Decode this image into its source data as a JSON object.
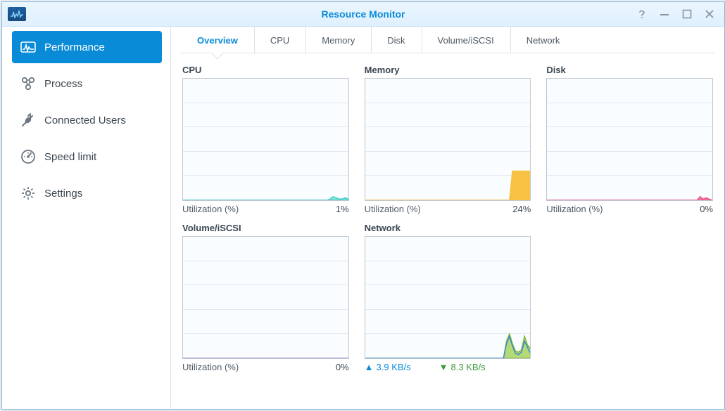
{
  "window": {
    "title": "Resource Monitor"
  },
  "sidebar": {
    "items": [
      {
        "label": "Performance",
        "active": true
      },
      {
        "label": "Process"
      },
      {
        "label": "Connected Users"
      },
      {
        "label": "Speed limit"
      },
      {
        "label": "Settings"
      }
    ]
  },
  "tabs": [
    {
      "label": "Overview",
      "active": true
    },
    {
      "label": "CPU"
    },
    {
      "label": "Memory"
    },
    {
      "label": "Disk"
    },
    {
      "label": "Volume/iSCSI"
    },
    {
      "label": "Network"
    }
  ],
  "cards": {
    "cpu": {
      "title": "CPU",
      "caption_label": "Utilization (%)",
      "caption_value": "1%"
    },
    "memory": {
      "title": "Memory",
      "caption_label": "Utilization (%)",
      "caption_value": "24%"
    },
    "disk": {
      "title": "Disk",
      "caption_label": "Utilization (%)",
      "caption_value": "0%"
    },
    "volume": {
      "title": "Volume/iSCSI",
      "caption_label": "Utilization (%)",
      "caption_value": "0%"
    },
    "network": {
      "title": "Network",
      "upload": "3.9 KB/s",
      "download": "8.3 KB/s"
    }
  },
  "chart_data": [
    {
      "id": "cpu",
      "type": "area",
      "ylim": [
        0,
        100
      ],
      "ylabel": "Utilization (%)",
      "latest": 1,
      "values": [
        0,
        0,
        0,
        0,
        0,
        0,
        0,
        0,
        0,
        0,
        0,
        0,
        0,
        0,
        0,
        0,
        0,
        0,
        0,
        0,
        0,
        0,
        0,
        0,
        0,
        0,
        0,
        0,
        0,
        0,
        0,
        0,
        0,
        0,
        0,
        0,
        0,
        0,
        0,
        0,
        0,
        0,
        0,
        0,
        0,
        0,
        0,
        0,
        0,
        1,
        3,
        2,
        1,
        1,
        2,
        1
      ]
    },
    {
      "id": "memory",
      "type": "area",
      "ylim": [
        0,
        100
      ],
      "ylabel": "Utilization (%)",
      "latest": 24,
      "values": [
        0,
        0,
        0,
        0,
        0,
        0,
        0,
        0,
        0,
        0,
        0,
        0,
        0,
        0,
        0,
        0,
        0,
        0,
        0,
        0,
        0,
        0,
        0,
        0,
        0,
        0,
        0,
        0,
        0,
        0,
        0,
        0,
        0,
        0,
        0,
        0,
        0,
        0,
        0,
        0,
        0,
        0,
        0,
        0,
        0,
        0,
        0,
        0,
        0,
        24,
        24,
        24,
        24,
        24,
        24,
        24
      ]
    },
    {
      "id": "disk",
      "type": "area",
      "ylim": [
        0,
        100
      ],
      "ylabel": "Utilization (%)",
      "latest": 0,
      "values": [
        0,
        0,
        0,
        0,
        0,
        0,
        0,
        0,
        0,
        0,
        0,
        0,
        0,
        0,
        0,
        0,
        0,
        0,
        0,
        0,
        0,
        0,
        0,
        0,
        0,
        0,
        0,
        0,
        0,
        0,
        0,
        0,
        0,
        0,
        0,
        0,
        0,
        0,
        0,
        0,
        0,
        0,
        0,
        0,
        0,
        0,
        0,
        0,
        0,
        0,
        0,
        3,
        1,
        2,
        1,
        0
      ]
    },
    {
      "id": "volume",
      "type": "area",
      "ylim": [
        0,
        100
      ],
      "ylabel": "Utilization (%)",
      "latest": 0,
      "values": [
        0,
        0,
        0,
        0,
        0,
        0,
        0,
        0,
        0,
        0,
        0,
        0,
        0,
        0,
        0,
        0,
        0,
        0,
        0,
        0,
        0,
        0,
        0,
        0,
        0,
        0,
        0,
        0,
        0,
        0,
        0,
        0,
        0,
        0,
        0,
        0,
        0,
        0,
        0,
        0,
        0,
        0,
        0,
        0,
        0,
        0,
        0,
        0,
        0,
        0,
        0,
        0,
        0,
        0,
        0,
        0
      ]
    },
    {
      "id": "network",
      "type": "area",
      "ylim": [
        0,
        100
      ],
      "ylabel": "KB/s",
      "upload_latest": 3.9,
      "download_latest": 8.3,
      "series": [
        {
          "name": "upload",
          "values": [
            0,
            0,
            0,
            0,
            0,
            0,
            0,
            0,
            0,
            0,
            0,
            0,
            0,
            0,
            0,
            0,
            0,
            0,
            0,
            0,
            0,
            0,
            0,
            0,
            0,
            0,
            0,
            0,
            0,
            0,
            0,
            0,
            0,
            0,
            0,
            0,
            0,
            0,
            0,
            0,
            0,
            0,
            0,
            0,
            0,
            0,
            0,
            12,
            18,
            10,
            4,
            3,
            5,
            14,
            9,
            4
          ]
        },
        {
          "name": "download",
          "values": [
            0,
            0,
            0,
            0,
            0,
            0,
            0,
            0,
            0,
            0,
            0,
            0,
            0,
            0,
            0,
            0,
            0,
            0,
            0,
            0,
            0,
            0,
            0,
            0,
            0,
            0,
            0,
            0,
            0,
            0,
            0,
            0,
            0,
            0,
            0,
            0,
            0,
            0,
            0,
            0,
            0,
            0,
            0,
            0,
            0,
            0,
            0,
            14,
            20,
            12,
            6,
            5,
            7,
            18,
            11,
            8
          ]
        }
      ]
    }
  ]
}
